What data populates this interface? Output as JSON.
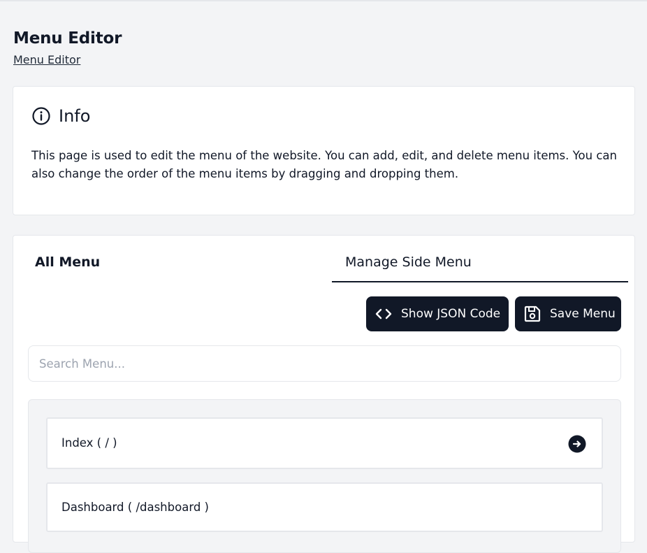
{
  "header": {
    "title": "Menu Editor",
    "breadcrumb": "Menu Editor"
  },
  "info": {
    "icon": "info-circle-icon",
    "title": "Info",
    "text": "This page is used to edit the menu of the website. You can add, edit, and delete menu items. You can also change the order of the menu items by dragging and dropping them."
  },
  "tabs": [
    {
      "label": "All Menu",
      "active": false
    },
    {
      "label": "Manage Side Menu",
      "active": true
    }
  ],
  "toolbar": {
    "json_label": "Show JSON Code",
    "json_icon": "code-icon",
    "save_label": "Save Menu",
    "save_icon": "floppy-disk-icon"
  },
  "search": {
    "placeholder": "Search Menu...",
    "value": ""
  },
  "menu_items": [
    {
      "label": "Index ( / )",
      "action_icon": "arrow-right-circle-icon"
    },
    {
      "label": "Dashboard ( /dashboard )"
    }
  ],
  "colors": {
    "background": "#f3f4f6",
    "card": "#ffffff",
    "primary": "#111827",
    "border": "#e5e7eb",
    "placeholder": "#9ca3af"
  }
}
